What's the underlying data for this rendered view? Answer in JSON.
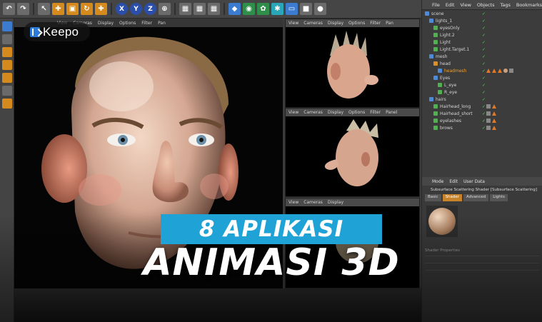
{
  "brand": {
    "name": "Keepo"
  },
  "headline": {
    "line1": "8 APLIKASI",
    "line2": "ANIMASI 3D"
  },
  "viewport_menu": [
    "View",
    "Cameras",
    "Display",
    "Options",
    "Filter",
    "Pan"
  ],
  "side_viewport_menu": [
    "View",
    "Cameras",
    "Display",
    "Options",
    "Filter",
    "Panel"
  ],
  "object_manager": {
    "menu": [
      "File",
      "Edit",
      "View",
      "Objects",
      "Tags",
      "Bookmarks"
    ],
    "rows": [
      {
        "name": "scene",
        "indent": 0,
        "icon": "b"
      },
      {
        "name": "lights_1",
        "indent": 1,
        "icon": "b"
      },
      {
        "name": "eyesOnly",
        "indent": 2,
        "icon": "g"
      },
      {
        "name": "Light.2",
        "indent": 2,
        "icon": "g"
      },
      {
        "name": "Light",
        "indent": 2,
        "icon": "g"
      },
      {
        "name": "Light.Target.1",
        "indent": 2,
        "icon": "g"
      },
      {
        "name": "mesh",
        "indent": 1,
        "icon": "b"
      },
      {
        "name": "head",
        "indent": 2,
        "icon": "o"
      },
      {
        "name": "headmesh",
        "indent": 3,
        "icon": "b",
        "selected": true
      },
      {
        "name": "Eyes",
        "indent": 2,
        "icon": "b"
      },
      {
        "name": "L_eye",
        "indent": 3,
        "icon": "g"
      },
      {
        "name": "R_eye",
        "indent": 3,
        "icon": "g"
      },
      {
        "name": "hairs",
        "indent": 1,
        "icon": "b"
      },
      {
        "name": "Hairhead_long",
        "indent": 2,
        "icon": "g"
      },
      {
        "name": "Hairhead_short",
        "indent": 2,
        "icon": "g"
      },
      {
        "name": "eyelashes",
        "indent": 2,
        "icon": "g"
      },
      {
        "name": "brows",
        "indent": 2,
        "icon": "g"
      }
    ]
  },
  "attribute_manager": {
    "menu": [
      "Mode",
      "Edit",
      "User Data"
    ],
    "title": "Subsurface Scattering Shader [Subsurface Scattering]",
    "tabs": [
      "Basic",
      "Shader",
      "Advanced",
      "Lights"
    ],
    "active_tab": "Shader",
    "section": "Shader Properties"
  },
  "colors": {
    "accent_band": "#1fa3d6",
    "brand_blue": "#2c7bd6"
  }
}
